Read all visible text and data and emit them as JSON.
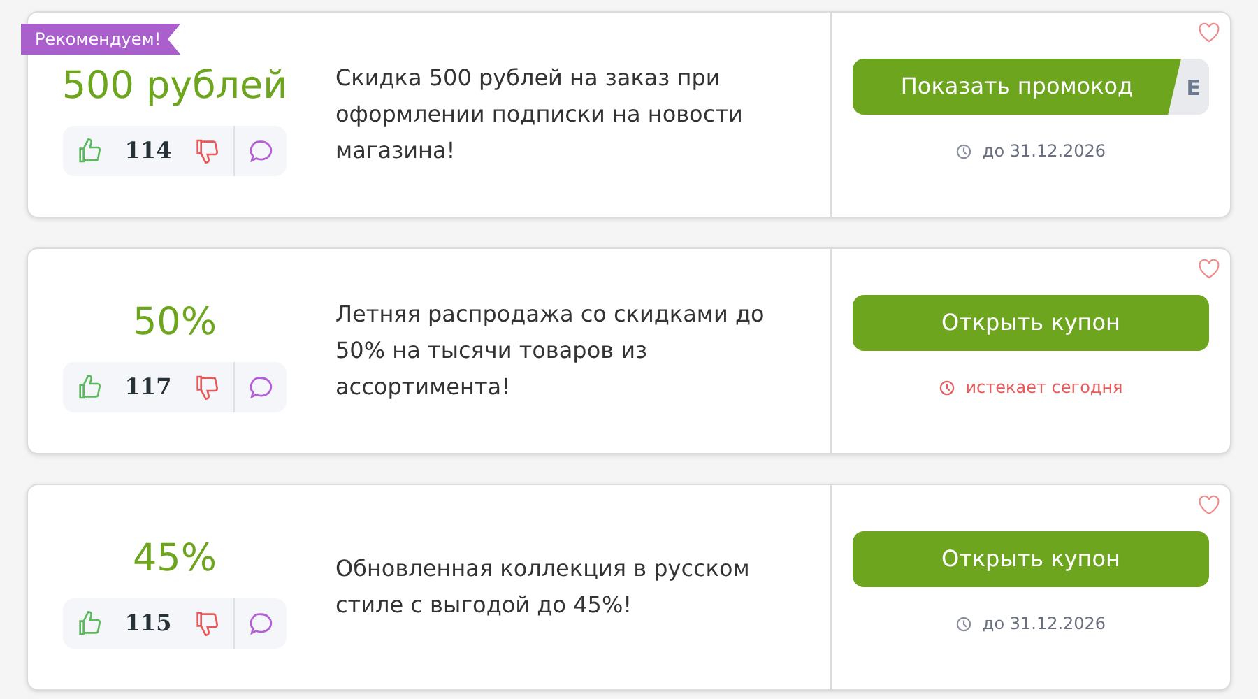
{
  "offers": [
    {
      "badge": "Рекомендуем!",
      "amount": "500 рублей",
      "votes": "114",
      "description": "Скидка 500 рублей на заказ при оформлении подписки на новости магазина!",
      "button": {
        "kind": "promo",
        "label": "Показать промокод",
        "code_hint": "E"
      },
      "expiry": {
        "kind": "date",
        "text": "до 31.12.2026"
      }
    },
    {
      "amount": "50%",
      "votes": "117",
      "description": "Летняя распродажа со скидками до 50% на тысячи товаров из ассортимента!",
      "button": {
        "kind": "coupon",
        "label": "Открыть купон"
      },
      "expiry": {
        "kind": "today",
        "text": "истекает сегодня"
      }
    },
    {
      "amount": "45%",
      "votes": "115",
      "description": "Обновленная коллекция в русском стиле с выгодой до 45%!",
      "button": {
        "kind": "coupon",
        "label": "Открыть купон"
      },
      "expiry": {
        "kind": "date",
        "text": "до 31.12.2026"
      }
    }
  ]
}
